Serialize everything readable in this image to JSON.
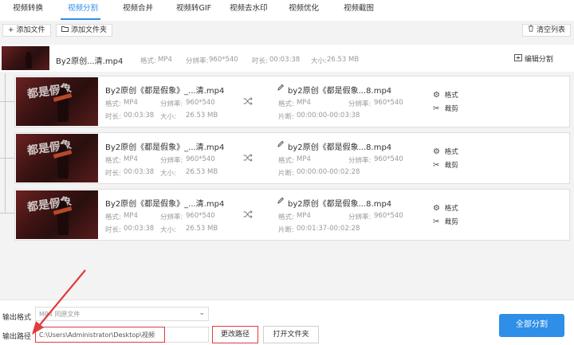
{
  "tabs": [
    {
      "label": "视频转换"
    },
    {
      "label": "视频分割"
    },
    {
      "label": "视频合并"
    },
    {
      "label": "视频转GIF"
    },
    {
      "label": "视频去水印"
    },
    {
      "label": "视频优化"
    },
    {
      "label": "视频截图"
    }
  ],
  "active_tab": "视频分割",
  "toolbar": {
    "add_file": "添加文件",
    "add_folder": "添加文件夹",
    "clear_list": "清空列表"
  },
  "source": {
    "name": "By2原创...清.mp4",
    "format_label": "格式:",
    "format": "MP4",
    "resolution_label": "分辨率:",
    "resolution": "960*540",
    "duration_label": "时长:",
    "duration": "00:03:38",
    "size_label": "大小:",
    "size": "26.53 MB",
    "edit_split": "编辑分割"
  },
  "segments": [
    {
      "src_name": "By2原创《都是假象》_...清.mp4",
      "format_label": "格式:",
      "format": "MP4",
      "resolution_label": "分辨率:",
      "resolution": "960*540",
      "duration_label": "时长:",
      "duration": "00:03:38",
      "size_label": "大小:",
      "size": "26.53 MB",
      "out_name": "by2原创《都是假象...8.mp4",
      "out_format_label": "格式:",
      "out_format": "MP4",
      "out_resolution_label": "分辨率:",
      "out_resolution": "960*540",
      "clip_label": "片断:",
      "clip": "00:00:00-00:03:38",
      "format_action": "格式",
      "crop_action": "裁剪"
    },
    {
      "src_name": "By2原创《都是假象》_...清.mp4",
      "format_label": "格式:",
      "format": "MP4",
      "resolution_label": "分辨率:",
      "resolution": "960*540",
      "duration_label": "时长:",
      "duration": "00:03:38",
      "size_label": "大小:",
      "size": "26.53 MB",
      "out_name": "by2原创《都是假象...8.mp4",
      "out_format_label": "格式:",
      "out_format": "MP4",
      "out_resolution_label": "分辨率:",
      "out_resolution": "960*540",
      "clip_label": "片断:",
      "clip": "00:00:00-00:02:28",
      "format_action": "格式",
      "crop_action": "裁剪"
    },
    {
      "src_name": "By2原创《都是假象》_...清.mp4",
      "format_label": "格式:",
      "format": "MP4",
      "resolution_label": "分辨率:",
      "resolution": "960*540",
      "duration_label": "时长:",
      "duration": "00:03:38",
      "size_label": "大小:",
      "size": "26.53 MB",
      "out_name": "by2原创《都是假象...8.mp4",
      "out_format_label": "格式:",
      "out_format": "MP4",
      "out_resolution_label": "分辨率:",
      "out_resolution": "960*540",
      "clip_label": "片断:",
      "clip": "00:01:37-00:02:28",
      "format_action": "格式",
      "crop_action": "裁剪"
    }
  ],
  "thumb_text": "都是假象",
  "bottom": {
    "output_format_label": "输出格式",
    "output_format_value": "MP4  同原文件",
    "output_path_label": "输出路径",
    "output_path_value": "C:\\Users\\Administrator\\Desktop\\视频",
    "change_path": "更改路径",
    "open_folder": "打开文件夹",
    "split_all": "全部分割"
  },
  "colors": {
    "accent": "#2e8ee8",
    "highlight": "#e23b3b"
  },
  "icons": {
    "add": "plus-icon",
    "folder": "folder-icon",
    "trash": "trash-icon",
    "edit": "edit-split-icon",
    "pencil": "pencil-icon",
    "shuffle": "shuffle-icon",
    "gear": "gear-icon",
    "scissors": "scissors-icon",
    "chevron": "chevron-down-icon"
  }
}
